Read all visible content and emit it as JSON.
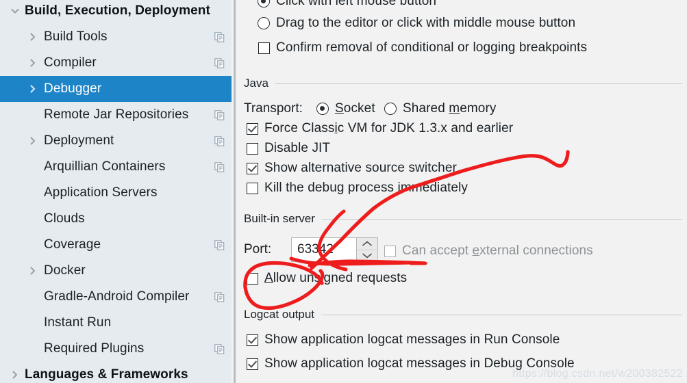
{
  "sidebar": {
    "background_color": "#e6ebef",
    "selected_color": "#1e84c8",
    "items": [
      {
        "label": "Build, Execution, Deployment",
        "indent": 0,
        "arrow": "chevron-down-icon",
        "bold": true,
        "copy_icon": false,
        "selected": false
      },
      {
        "label": "Build Tools",
        "indent": 1,
        "arrow": "chevron-right-icon",
        "bold": false,
        "copy_icon": true,
        "selected": false
      },
      {
        "label": "Compiler",
        "indent": 1,
        "arrow": "chevron-right-icon",
        "bold": false,
        "copy_icon": true,
        "selected": false
      },
      {
        "label": "Debugger",
        "indent": 1,
        "arrow": "chevron-right-icon",
        "bold": false,
        "copy_icon": false,
        "selected": true
      },
      {
        "label": "Remote Jar Repositories",
        "indent": 1,
        "arrow": "none",
        "bold": false,
        "copy_icon": true,
        "selected": false
      },
      {
        "label": "Deployment",
        "indent": 1,
        "arrow": "chevron-right-icon",
        "bold": false,
        "copy_icon": true,
        "selected": false
      },
      {
        "label": "Arquillian Containers",
        "indent": 1,
        "arrow": "none",
        "bold": false,
        "copy_icon": true,
        "selected": false
      },
      {
        "label": "Application Servers",
        "indent": 1,
        "arrow": "none",
        "bold": false,
        "copy_icon": false,
        "selected": false
      },
      {
        "label": "Clouds",
        "indent": 1,
        "arrow": "none",
        "bold": false,
        "copy_icon": false,
        "selected": false
      },
      {
        "label": "Coverage",
        "indent": 1,
        "arrow": "none",
        "bold": false,
        "copy_icon": true,
        "selected": false
      },
      {
        "label": "Docker",
        "indent": 1,
        "arrow": "chevron-right-icon",
        "bold": false,
        "copy_icon": false,
        "selected": false
      },
      {
        "label": "Gradle-Android Compiler",
        "indent": 1,
        "arrow": "none",
        "bold": false,
        "copy_icon": true,
        "selected": false
      },
      {
        "label": "Instant Run",
        "indent": 1,
        "arrow": "none",
        "bold": false,
        "copy_icon": false,
        "selected": false
      },
      {
        "label": "Required Plugins",
        "indent": 1,
        "arrow": "none",
        "bold": false,
        "copy_icon": true,
        "selected": false
      },
      {
        "label": "Languages & Frameworks",
        "indent": 0,
        "arrow": "chevron-right-icon",
        "bold": true,
        "copy_icon": false,
        "selected": false
      }
    ]
  },
  "panel": {
    "breakpoint_options": {
      "click_left_mouse": {
        "label": "Click with left mouse button",
        "checked": true
      },
      "drag_to_editor": {
        "label": "Drag to the editor or click with middle mouse button",
        "checked": false
      },
      "confirm_removal": {
        "label": "Confirm removal of conditional or logging breakpoints",
        "checked": false
      }
    },
    "java_section": {
      "title": "Java",
      "transport_label": "Transport:",
      "transport_options": [
        {
          "label": "Socket",
          "mnemonic": "S",
          "checked": true
        },
        {
          "label": "Shared memory",
          "mnemonic": "m",
          "checked": false
        }
      ],
      "checkboxes": [
        {
          "label": "Force Classic VM for JDK 1.3.x and earlier",
          "mnemonic": "i",
          "checked": true,
          "disabled": false
        },
        {
          "label": "Disable JIT",
          "mnemonic": "",
          "checked": false,
          "disabled": false
        },
        {
          "label": "Show alternative source switcher",
          "mnemonic": "",
          "checked": true,
          "disabled": false
        },
        {
          "label": "Kill the debug process immediately",
          "mnemonic": "",
          "checked": false,
          "disabled": false
        }
      ]
    },
    "builtin_server_section": {
      "title": "Built-in server",
      "port_label": "Port:",
      "port_value": "63342",
      "can_accept_external": {
        "label_before": "Can accept ",
        "mnemonic": "e",
        "label_after": "xternal connections",
        "checked": false,
        "disabled": true
      },
      "allow_unsigned": {
        "mnemonic": "A",
        "label_after": "llow unsigned requests",
        "checked": false,
        "disabled": false
      }
    },
    "logcat_section": {
      "title": "Logcat output",
      "checkboxes": [
        {
          "label": "Show application logcat messages in Run Console",
          "checked": true
        },
        {
          "label": "Show application logcat messages in Debug Console",
          "checked": true
        }
      ]
    }
  },
  "annotation": {
    "color": "#ee1d1d",
    "shapes": [
      "stroke-through-port-field",
      "long-diagonal-stroke",
      "circle-around-allow-unsigned"
    ]
  },
  "watermark": {
    "text": "https://blog.csdn.net/w200382522"
  }
}
